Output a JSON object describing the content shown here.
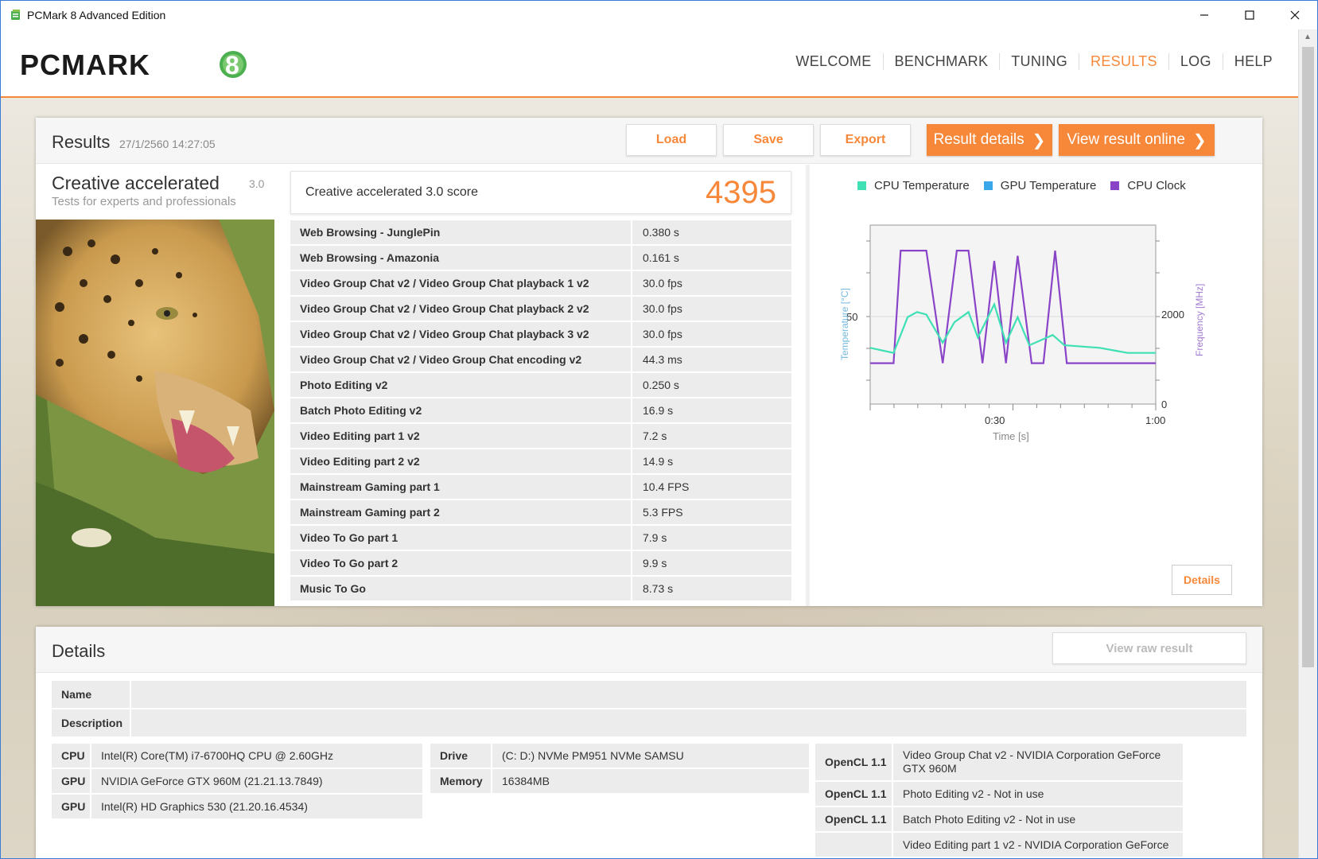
{
  "window": {
    "title": "PCMark 8 Advanced Edition",
    "minimize": "—",
    "maximize": "☐",
    "close": "✕"
  },
  "logo": {
    "text": "PCMARK",
    "mark": "8"
  },
  "nav": [
    "WELCOME",
    "BENCHMARK",
    "TUNING",
    "RESULTS",
    "LOG",
    "HELP"
  ],
  "nav_active": "RESULTS",
  "results": {
    "title": "Results",
    "date": "27/1/2560 14:27:05",
    "buttons": {
      "load": "Load",
      "save": "Save",
      "export": "Export",
      "details": "Result details",
      "online": "View result online"
    },
    "test": {
      "name": "Creative accelerated",
      "version": "3.0",
      "subtitle": "Tests for experts and professionals"
    },
    "score": {
      "label": "Creative accelerated 3.0 score",
      "value": "4395"
    },
    "rows": [
      {
        "name": "Web Browsing - JunglePin",
        "value": "0.380 s"
      },
      {
        "name": "Web Browsing - Amazonia",
        "value": "0.161 s"
      },
      {
        "name": "Video Group Chat v2 / Video Group Chat playback 1 v2",
        "value": "30.0 fps"
      },
      {
        "name": "Video Group Chat v2 / Video Group Chat playback 2 v2",
        "value": "30.0 fps"
      },
      {
        "name": "Video Group Chat v2 / Video Group Chat playback 3 v2",
        "value": "30.0 fps"
      },
      {
        "name": "Video Group Chat v2 / Video Group Chat encoding v2",
        "value": "44.3 ms"
      },
      {
        "name": "Photo Editing v2",
        "value": "0.250 s"
      },
      {
        "name": "Batch Photo Editing v2",
        "value": "16.9 s"
      },
      {
        "name": "Video Editing part 1 v2",
        "value": "7.2 s"
      },
      {
        "name": "Video Editing part 2 v2",
        "value": "14.9 s"
      },
      {
        "name": "Mainstream Gaming part 1",
        "value": "10.4 FPS"
      },
      {
        "name": "Mainstream Gaming part 2",
        "value": "5.3 FPS"
      },
      {
        "name": "Video To Go part 1",
        "value": "7.9 s"
      },
      {
        "name": "Video To Go part 2",
        "value": "9.9 s"
      },
      {
        "name": "Music To Go",
        "value": "8.73 s"
      }
    ],
    "chart_details_button": "Details"
  },
  "chart_data": {
    "type": "line",
    "legend": [
      "CPU Temperature",
      "GPU Temperature",
      "CPU Clock"
    ],
    "colors": {
      "cpu_temp": "#3ee0b4",
      "gpu_temp": "#3aa8e8",
      "cpu_clock": "#8a44c8"
    },
    "xlabel": "Time [s]",
    "ylabel_left": "Temperature [°C]",
    "ylabel_right": "Frequency [MHz]",
    "x_ticks": [
      "0:30",
      "1:00"
    ],
    "y_left_ticks": [
      "50"
    ],
    "y_right_ticks": [
      "2000",
      "0"
    ],
    "xlim": [
      0,
      61
    ],
    "ylim_right": [
      0,
      3500
    ],
    "series": [
      {
        "name": "CPU Clock",
        "axis": "right",
        "points": [
          [
            0,
            800
          ],
          [
            5,
            800
          ],
          [
            6.5,
            3000
          ],
          [
            12,
            3000
          ],
          [
            15.5,
            800
          ],
          [
            18.5,
            3000
          ],
          [
            21,
            3000
          ],
          [
            24,
            800
          ],
          [
            26.5,
            2800
          ],
          [
            29,
            800
          ],
          [
            31.5,
            2900
          ],
          [
            34.5,
            800
          ],
          [
            37,
            800
          ],
          [
            39.5,
            3000
          ],
          [
            42,
            800
          ],
          [
            61,
            800
          ]
        ]
      },
      {
        "name": "CPU Temperature",
        "axis": "right",
        "points": [
          [
            0,
            1100
          ],
          [
            5,
            1000
          ],
          [
            8,
            1700
          ],
          [
            10,
            1800
          ],
          [
            12,
            1750
          ],
          [
            15.5,
            1200
          ],
          [
            18,
            1600
          ],
          [
            21,
            1800
          ],
          [
            23,
            1300
          ],
          [
            26.5,
            1950
          ],
          [
            29,
            1200
          ],
          [
            31.5,
            1700
          ],
          [
            34,
            1150
          ],
          [
            39,
            1350
          ],
          [
            41.5,
            1150
          ],
          [
            49,
            1100
          ],
          [
            52,
            1050
          ],
          [
            55,
            1000
          ],
          [
            61,
            1000
          ]
        ]
      }
    ]
  },
  "details": {
    "title": "Details",
    "raw_button": "View raw result",
    "name_label": "Name",
    "name_value": "",
    "description_label": "Description",
    "description_value": "",
    "system": [
      {
        "key": "CPU",
        "value": "Intel(R) Core(TM) i7-6700HQ CPU @ 2.60GHz"
      },
      {
        "key": "GPU",
        "value": "NVIDIA GeForce GTX 960M (21.21.13.7849)"
      },
      {
        "key": "GPU",
        "value": "Intel(R) HD Graphics 530 (21.20.16.4534)"
      }
    ],
    "storage": [
      {
        "key": "Drive",
        "value": "(C: D:) NVMe PM951 NVMe SAMSU"
      },
      {
        "key": "Memory",
        "value": "16384MB"
      }
    ],
    "opencl": [
      {
        "key": "OpenCL 1.1",
        "value": "Video Group Chat v2 - NVIDIA Corporation GeForce GTX 960M"
      },
      {
        "key": "OpenCL 1.1",
        "value": "Photo Editing v2 - Not in use"
      },
      {
        "key": "OpenCL 1.1",
        "value": "Batch Photo Editing v2 - Not in use"
      },
      {
        "key": "",
        "value": "Video Editing part 1 v2 - NVIDIA Corporation GeForce"
      }
    ]
  }
}
